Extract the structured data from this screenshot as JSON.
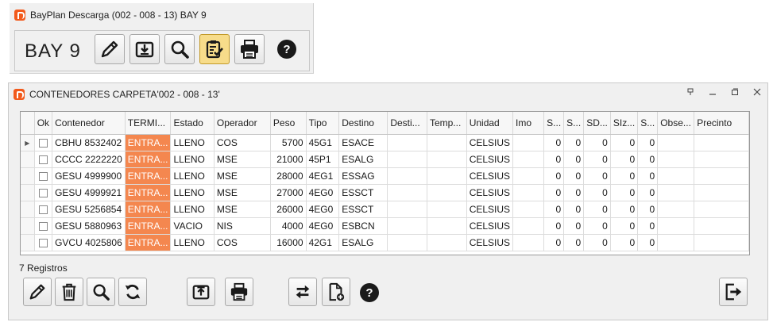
{
  "bay_window": {
    "title": "BayPlan Descarga (002 - 008 - 13) BAY 9",
    "bay_label": "BAY 9",
    "toolbar": [
      {
        "name": "edit-button",
        "icon": "pencil-icon",
        "active": false
      },
      {
        "name": "download-button",
        "icon": "download-tray-icon",
        "active": false
      },
      {
        "name": "search-button",
        "icon": "magnifier-icon",
        "active": false
      },
      {
        "name": "checklist-button",
        "icon": "clipboard-check-icon",
        "active": true
      },
      {
        "name": "print-button",
        "icon": "printer-icon",
        "active": false
      }
    ],
    "help_label": "?"
  },
  "containers_window": {
    "title": "CONTENEDORES CARPETA'002 - 008 - 13'",
    "columns": [
      "",
      "Ok",
      "Contenedor",
      "TERMI...",
      "Estado",
      "Operador",
      "Peso",
      "Tipo",
      "Destino",
      "Desti...",
      "Temp...",
      "Unidad",
      "Imo",
      "S...",
      "S...",
      "SD...",
      "SIz...",
      "S...",
      "Obse...",
      "Precinto"
    ],
    "rows": [
      {
        "contenedor": "CBHU 8532402",
        "terminal": "ENTRA...",
        "estado": "LLENO",
        "operador": "COS",
        "peso": "5700",
        "tipo": "45G1",
        "destino": "ESACE",
        "destino2": "",
        "temp": "",
        "unidad": "CELSIUS",
        "imo": "",
        "s1": "0",
        "s2": "0",
        "sd": "0",
        "siz": "0",
        "s3": "0",
        "obse": "",
        "precinto": ""
      },
      {
        "contenedor": "CCCC 2222220",
        "terminal": "ENTRA...",
        "estado": "LLENO",
        "operador": "MSE",
        "peso": "21000",
        "tipo": "45P1",
        "destino": "ESALG",
        "destino2": "",
        "temp": "",
        "unidad": "CELSIUS",
        "imo": "",
        "s1": "0",
        "s2": "0",
        "sd": "0",
        "siz": "0",
        "s3": "0",
        "obse": "",
        "precinto": ""
      },
      {
        "contenedor": "GESU 4999900",
        "terminal": "ENTRA...",
        "estado": "LLENO",
        "operador": "MSE",
        "peso": "28000",
        "tipo": "4EG1",
        "destino": "ESSAG",
        "destino2": "",
        "temp": "",
        "unidad": "CELSIUS",
        "imo": "",
        "s1": "0",
        "s2": "0",
        "sd": "0",
        "siz": "0",
        "s3": "0",
        "obse": "",
        "precinto": ""
      },
      {
        "contenedor": "GESU 4999921",
        "terminal": "ENTRA...",
        "estado": "LLENO",
        "operador": "MSE",
        "peso": "27000",
        "tipo": "4EG0",
        "destino": "ESSCT",
        "destino2": "",
        "temp": "",
        "unidad": "CELSIUS",
        "imo": "",
        "s1": "0",
        "s2": "0",
        "sd": "0",
        "siz": "0",
        "s3": "0",
        "obse": "",
        "precinto": ""
      },
      {
        "contenedor": "GESU 5256854",
        "terminal": "ENTRA...",
        "estado": "LLENO",
        "operador": "MSE",
        "peso": "26000",
        "tipo": "4EG0",
        "destino": "ESSCT",
        "destino2": "",
        "temp": "",
        "unidad": "CELSIUS",
        "imo": "",
        "s1": "0",
        "s2": "0",
        "sd": "0",
        "siz": "0",
        "s3": "0",
        "obse": "",
        "precinto": ""
      },
      {
        "contenedor": "GESU 5880963",
        "terminal": "ENTRA...",
        "estado": "VACIO",
        "operador": "NIS",
        "peso": "4000",
        "tipo": "4EG0",
        "destino": "ESBCN",
        "destino2": "",
        "temp": "",
        "unidad": "CELSIUS",
        "imo": "",
        "s1": "0",
        "s2": "0",
        "sd": "0",
        "siz": "0",
        "s3": "0",
        "obse": "",
        "precinto": ""
      },
      {
        "contenedor": "GVCU 4025806",
        "terminal": "ENTRA...",
        "estado": "LLENO",
        "operador": "COS",
        "peso": "16000",
        "tipo": "42G1",
        "destino": "ESALG",
        "destino2": "",
        "temp": "",
        "unidad": "CELSIUS",
        "imo": "",
        "s1": "0",
        "s2": "0",
        "sd": "0",
        "siz": "0",
        "s3": "0",
        "obse": "",
        "precinto": ""
      }
    ],
    "record_count": "7 Registros",
    "toolbar": [
      {
        "name": "edit-button",
        "icon": "pencil-icon"
      },
      {
        "name": "delete-button",
        "icon": "trash-icon"
      },
      {
        "name": "search-button",
        "icon": "magnifier-icon"
      },
      {
        "name": "refresh-button",
        "icon": "refresh-icon"
      },
      {
        "name": "upload-button",
        "icon": "upload-tray-icon"
      },
      {
        "name": "print-button",
        "icon": "printer-icon"
      },
      {
        "name": "swap-button",
        "icon": "swap-arrows-icon"
      },
      {
        "name": "new-document-button",
        "icon": "new-document-icon"
      },
      {
        "name": "exit-button",
        "icon": "exit-icon"
      }
    ],
    "help_label": "?",
    "colors": {
      "terminal_cell": "#f4874f",
      "active_button": "#f7dc8a"
    }
  }
}
